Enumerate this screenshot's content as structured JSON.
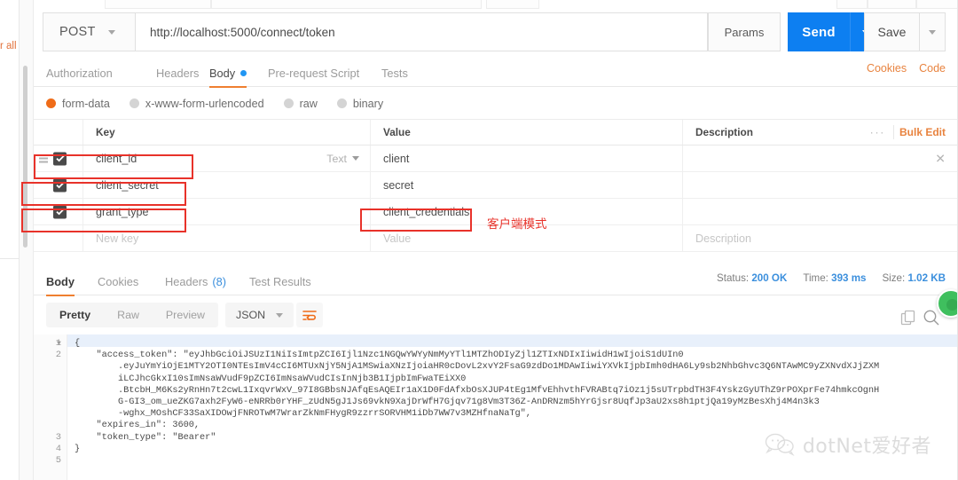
{
  "sidebar": {
    "cut_label": "r all"
  },
  "request": {
    "method": "POST",
    "url": "http://localhost:5000/connect/token",
    "params_label": "Params",
    "send_label": "Send",
    "save_label": "Save"
  },
  "request_tabs": [
    {
      "label": "Authorization",
      "active": false,
      "dot": false
    },
    {
      "label": "Headers",
      "active": false,
      "dot": false
    },
    {
      "label": "Body",
      "active": true,
      "dot": true
    },
    {
      "label": "Pre-request Script",
      "active": false,
      "dot": false
    },
    {
      "label": "Tests",
      "active": false,
      "dot": false
    }
  ],
  "header_links": [
    {
      "label": "Cookies"
    },
    {
      "label": "Code"
    }
  ],
  "body_types": [
    {
      "label": "form-data",
      "selected": true
    },
    {
      "label": "x-www-form-urlencoded",
      "selected": false
    },
    {
      "label": "raw",
      "selected": false
    },
    {
      "label": "binary",
      "selected": false
    }
  ],
  "kv_table": {
    "columns": {
      "key": "Key",
      "value": "Value",
      "description": "Description"
    },
    "bulk_edit_label": "Bulk Edit",
    "more_label": "···",
    "type_dropdown": "Text",
    "rows": [
      {
        "checked": true,
        "key": "client_id",
        "value": "client",
        "description": ""
      },
      {
        "checked": true,
        "key": "client_secret",
        "value": "secret",
        "description": ""
      },
      {
        "checked": true,
        "key": "grant_type",
        "value": "client_credentials",
        "description": ""
      }
    ],
    "new_row": {
      "key_placeholder": "New key",
      "value_placeholder": "Value",
      "description_placeholder": "Description"
    }
  },
  "annotation": {
    "chinese_note": "客户端模式"
  },
  "response_tabs": [
    {
      "label": "Body",
      "active": true,
      "count": ""
    },
    {
      "label": "Cookies",
      "active": false,
      "count": ""
    },
    {
      "label": "Headers",
      "active": false,
      "count": "(8)"
    },
    {
      "label": "Test Results",
      "active": false,
      "count": ""
    }
  ],
  "response_meta": {
    "status_label": "Status:",
    "status_value": "200 OK",
    "time_label": "Time:",
    "time_value": "393 ms",
    "size_label": "Size:",
    "size_value": "1.02 KB"
  },
  "view_toolbar": {
    "modes": [
      {
        "label": "Pretty",
        "active": true
      },
      {
        "label": "Raw",
        "active": false
      },
      {
        "label": "Preview",
        "active": false
      }
    ],
    "format": "JSON"
  },
  "response_body": {
    "line_numbers": [
      "1",
      "2",
      "3",
      "4",
      "5"
    ],
    "lines": [
      "{",
      "    \"access_token\": \"eyJhbGciOiJSUzI1NiIsImtpZCI6Ijl1Nzc1NGQwYWYyNmMyYTl1MTZhODIyZjl1ZTIxNDIxIiwidH1wIjoiS1dUIn0",
      "        .eyJuYmYiOjE1MTY2OTI0NTEsImV4cCI6MTUxNjY5NjA1MSwiaXNzIjoiaHR0cDovL2xvY2FsaG9zdDo1MDAwIiwiYXVkIjpbImh0dHA6Ly9sb2NhbGhvc3Q6NTAwMC9yZXNvdXJjZXM",
      "        iLCJhcGkxI10sImNsaWVudF9pZCI6ImNsaWVudCIsInNjb3B1IjpbImFwaTEiXX0",
      "        .BtcbH_M6Ks2yRnHn7t2cwL1IxqvrWxV_97I8GBbsNJAfqEsAQEIr1aX1D0FdAfxbOsXJUP4tEg1MfvEhhvthFVRABtq7iOz1j5sUTrpbdTH3F4YskzGyUThZ9rPOXprFe74hmkcOgnH",
      "        G-GI3_om_ueZKG7axh2FyW6-eNRRb0rYHF_zUdN5gJ1Js69vkN9XajDrWfH7Gjqv71g8Vm3T36Z-AnDRNzm5hYrGjsr8UqfJp3aU2xs8h1ptjQa19yMzBesXhj4M4n3k3",
      "        -wghx_MOshCF33SaXIDOwjFNROTwM7WrarZkNmFHygR9zzrrSORVHM1iDb7WW7v3MZHfnaNaTg\",",
      "    \"expires_in\": 3600,",
      "    \"token_type\": \"Bearer\"",
      "}"
    ],
    "fields": {
      "access_token_key": "access_token",
      "expires_in_key": "expires_in",
      "expires_in_value": "3600",
      "token_type_key": "token_type",
      "token_type_value": "Bearer"
    }
  },
  "watermark": {
    "text": "dotNet爱好者"
  },
  "colors": {
    "accent_orange": "#ef7f30",
    "send_blue": "#0d7ff1",
    "annotation_red": "#e8322a",
    "status_blue": "#3b8fdd",
    "badge_green": "#3fbf5e"
  }
}
